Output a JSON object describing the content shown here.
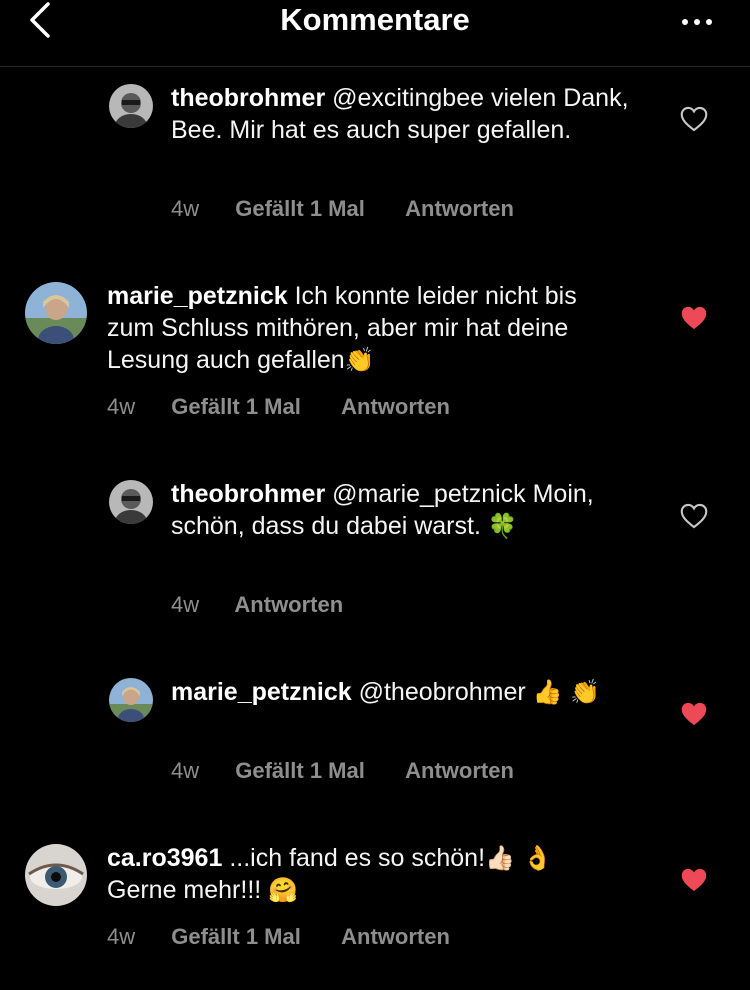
{
  "header": {
    "title": "Kommentare"
  },
  "comments": [
    {
      "username": "theobrohmer",
      "text": "@excitingbee vielen Dank, Bee. Mir hat es auch super gefallen.",
      "emoji": "",
      "time": "4w",
      "likes": "Gefällt 1 Mal",
      "reply": "Antworten",
      "liked": false
    },
    {
      "username": "marie_petznick",
      "text": "Ich konnte leider nicht bis zum Schluss mithören, aber mir hat deine Lesung auch gefallen",
      "emoji": "👏",
      "time": "4w",
      "likes": "Gefällt 1 Mal",
      "reply": "Antworten",
      "liked": true
    },
    {
      "username": "theobrohmer",
      "text": "@marie_petznick Moin, schön, dass du dabei warst.",
      "emoji": "🍀",
      "time": "4w",
      "likes": "",
      "reply": "Antworten",
      "liked": false
    },
    {
      "username": "marie_petznick",
      "text": "@theobrohmer",
      "emoji": "👍 👏",
      "time": "4w",
      "likes": "Gefällt 1 Mal",
      "reply": "Antworten",
      "liked": true
    },
    {
      "username": "ca.ro3961",
      "text": "...ich fand es so schön!",
      "emoji": "👍🏻 👌",
      "text2": "Gerne mehr!!!",
      "emoji2": "🤗",
      "time": "4w",
      "likes": "Gefällt 1 Mal",
      "reply": "Antworten",
      "liked": true
    }
  ],
  "colors": {
    "background": "#000000",
    "meta": "#8e8e8e",
    "heart_liked": "#ed4956",
    "heart_outline": "#c7c7c7"
  },
  "icons": [
    "back-chevron-icon",
    "more-dots-icon",
    "heart-icon"
  ]
}
